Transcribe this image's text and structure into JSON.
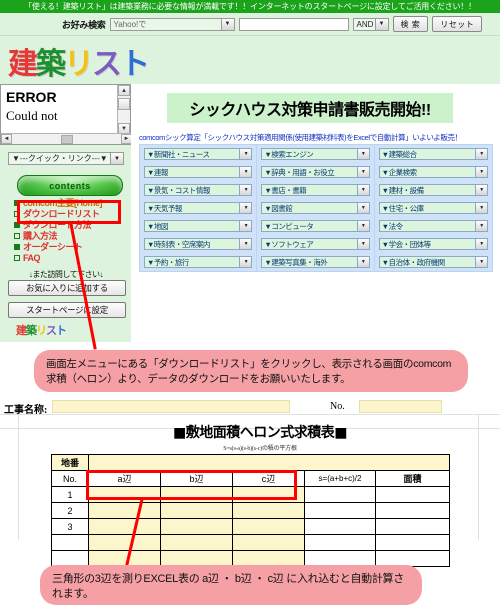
{
  "banner": {
    "text": "「使える！建築リスト」は建築業務に必要な情報が満載です！！インターネットのスタートページに設定してご活用ください！！"
  },
  "search": {
    "label": "お好み検索",
    "engine_value": "Yahoo!で",
    "query_value": "",
    "operator_value": "AND",
    "search_button": "検 索",
    "reset_button": "リセット"
  },
  "logo": {
    "chars": [
      "建",
      "築",
      "リ",
      "ス",
      "ト"
    ]
  },
  "error_box": {
    "line1": "ERROR",
    "line2": "Could not",
    "scroll_up": "▲",
    "scroll_down": "▼",
    "scroll_left": "◄",
    "scroll_right": "►"
  },
  "sidebar": {
    "quick_link": "▼---クイック・リンク---▼",
    "contents_label": "contents",
    "items": [
      {
        "label": "comcom主要[Home]",
        "marker": "filled"
      },
      {
        "label": "ダウンロードリスト",
        "marker": "open"
      },
      {
        "label": "ダウンロード方法",
        "marker": "filled"
      },
      {
        "label": "購入方法",
        "marker": "open"
      },
      {
        "label": "オーダーシート",
        "marker": "filled"
      },
      {
        "label": "FAQ",
        "marker": "open"
      }
    ],
    "revisit_text": "↓また訪問して下さい↓",
    "favorite_button": "お気に入りに追加する",
    "startpage_button": "スタートページに設定",
    "mini_logo": [
      "建",
      "築",
      "リ",
      "ス",
      "ト"
    ]
  },
  "main": {
    "headline": "シックハウス対策申請書販売開始!!",
    "subline": "comcomシック算定「シックハウス対策適用関係(使用建築材料表)をExcelで自動計算」いよいよ販売！",
    "dropdowns": [
      "▼新聞社・ニュース",
      "▼検索エンジン",
      "▼建築総合",
      "▼連報",
      "▼辞典・用語・お役立",
      "▼企業検索",
      "▼景気・コスト情報",
      "▼書店・書籍",
      "▼建材・設備",
      "▼天気予報",
      "▼図書館",
      "▼住宅・公庫",
      "▼地図",
      "▼コンピュータ",
      "▼法令",
      "▼時刻表・空席案内",
      "▼ソフトウェア",
      "▼学会・団体等",
      "▼予約・旅行",
      "▼建築写真集・海外",
      "▼自治体・政府機関"
    ]
  },
  "callouts": {
    "top": "画面左メニューにある「ダウンロードリスト」をクリックし、表示される画面のcomcom求積（ヘロン）より、データのダウンロードをお願いいたします。",
    "bottom": "三角形の3辺を測りEXCEL表の a辺 ・ b辺 ・ c辺 に入れ込むと自動計算されます。"
  },
  "sheet": {
    "project_label": "工事名称:",
    "project_value": "",
    "no_label": "No.",
    "no_value": "",
    "title": "■敷地面積ヘロン式求積表■",
    "formula": "S=s(s-a)(s-b)(s-c)の積の平方根",
    "chiban_label": "地番",
    "chiban_value": "",
    "columns": [
      "No.",
      "a辺",
      "b辺",
      "c辺",
      "s=(a+b+c)/2",
      "面積"
    ],
    "rows": [
      {
        "no": "1",
        "a": "",
        "b": "",
        "c": "",
        "s": "",
        "area": ""
      },
      {
        "no": "2",
        "a": "",
        "b": "",
        "c": "",
        "s": "",
        "area": ""
      },
      {
        "no": "3",
        "a": "",
        "b": "",
        "c": "",
        "s": "",
        "area": ""
      },
      {
        "no": "",
        "a": "",
        "b": "",
        "c": "",
        "s": "",
        "area": ""
      },
      {
        "no": "",
        "a": "",
        "b": "",
        "c": "",
        "s": "",
        "area": ""
      }
    ]
  },
  "colors": {
    "banner_green": "#1ba31b",
    "page_green": "#ddf3dd",
    "dropdown_blue": "#cfe2f7",
    "callout_pink": "#f4a0a4",
    "highlight_red": "#ff0000",
    "cell_yellow": "#fdf6cd"
  }
}
